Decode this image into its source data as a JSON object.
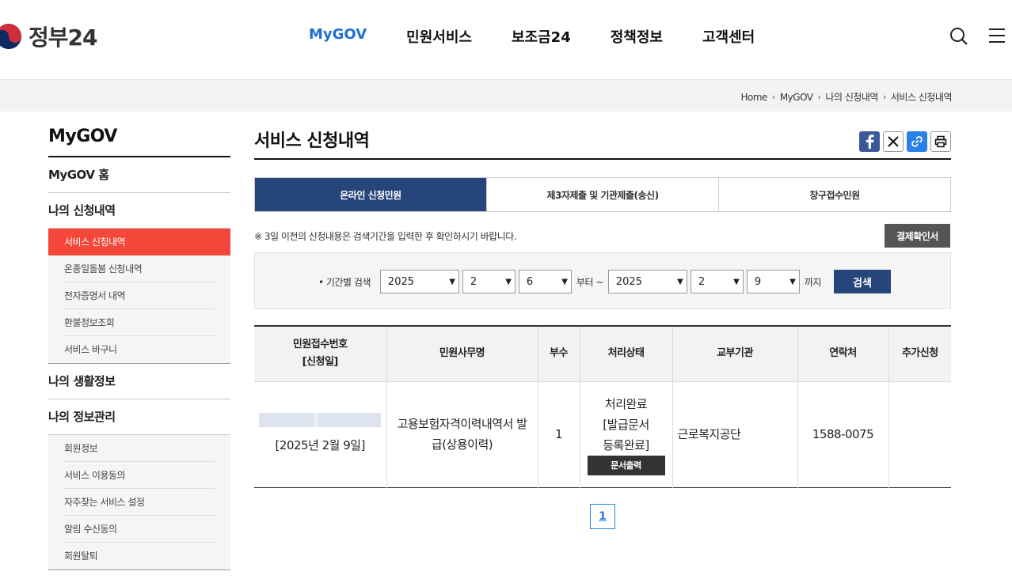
{
  "header": {
    "logo_text": "정부24",
    "nav": [
      "MyGOV",
      "민원서비스",
      "보조금24",
      "정책정보",
      "고객센터"
    ],
    "active_nav": "MyGOV",
    "icons": [
      "search-icon",
      "menu-icon"
    ]
  },
  "breadcrumb": [
    "Home",
    "MyGOV",
    "나의 신청내역",
    "서비스 신청내역"
  ],
  "sidebar": {
    "title": "MyGOV",
    "home": "MyGOV 홈",
    "section1": "나의 신청내역",
    "section1_items": [
      "서비스 신청내역",
      "온종일돌봄 신청내역",
      "전자증명서 내역",
      "환불정보조회",
      "서비스 바구니"
    ],
    "section2": "나의 생활정보",
    "section3": "나의 정보관리",
    "section3_items": [
      "회원정보",
      "서비스 이용동의",
      "자주찾는 서비스 설정",
      "알림 수신동의",
      "회원탈퇴"
    ]
  },
  "main": {
    "title": "서비스 신청내역",
    "share_icons": [
      "facebook-icon",
      "x-icon",
      "link-icon",
      "print-icon"
    ],
    "tabs": [
      "온라인 신청민원",
      "제3자제출 및 기관제출(송신)",
      "창구접수민원"
    ],
    "notice": "※ 3일 이전의 신청내용은 검색기간을 입력한 후 확인하시기 바랍니다.",
    "pay_button": "결제확인서",
    "search": {
      "label": "• 기간별 검색",
      "from_year": "2025",
      "from_month": "2",
      "from_day": "6",
      "from_suffix": "부터 ~",
      "to_year": "2025",
      "to_month": "2",
      "to_day": "9",
      "to_suffix": "까지",
      "button": "검색"
    },
    "table": {
      "headers": [
        "민원접수번호\n[신청일]",
        "민원사무명",
        "부수",
        "처리상태",
        "교부기관",
        "연락처",
        "추가신청"
      ],
      "row": {
        "date": "[2025년 2월 9일]",
        "service": "고용보험자격이력내역서 발급(상용이력)",
        "copies": "1",
        "status": "처리완료\n[발급문서\n등록완료]",
        "print_button": "문서출력",
        "agency": "근로복지공단",
        "contact": "1588-0075",
        "extra": ""
      }
    },
    "page": "1"
  }
}
